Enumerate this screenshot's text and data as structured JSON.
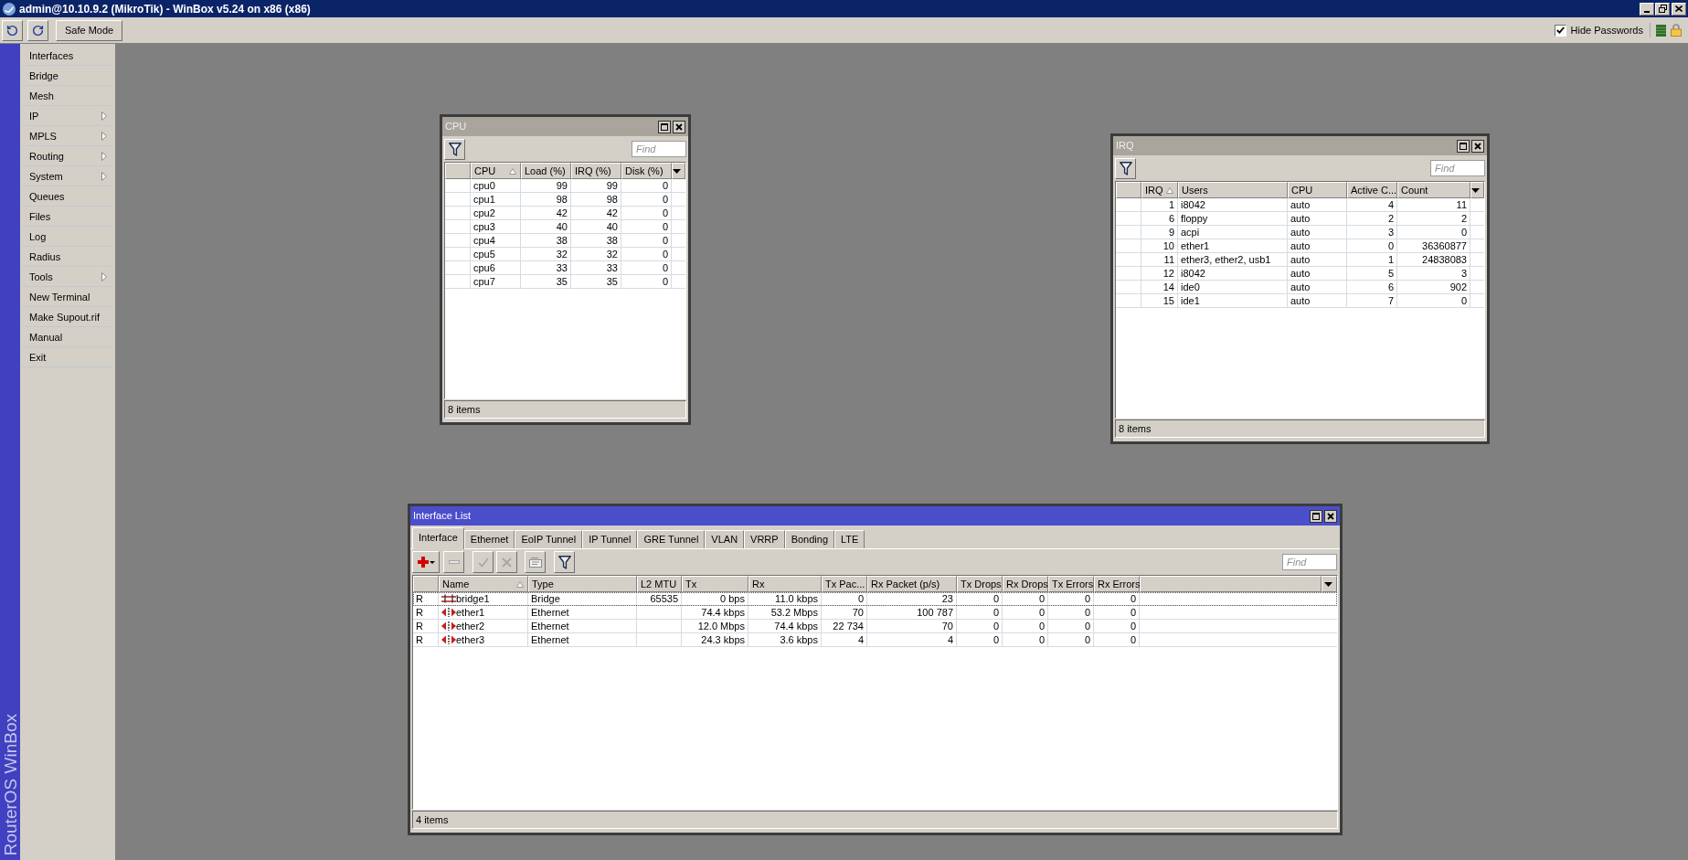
{
  "window": {
    "title": "admin@10.10.9.2 (MikroTik) - WinBox v5.24 on x86 (x86)"
  },
  "toolbar": {
    "safe_mode": {
      "label": "Safe Mode",
      "pressed": false
    },
    "hide_passwords": {
      "label": "Hide Passwords",
      "checked": true
    }
  },
  "sidebar": {
    "brand": "RouterOS WinBox",
    "items": [
      {
        "label": "Interfaces",
        "submenu": false
      },
      {
        "label": "Bridge",
        "submenu": false
      },
      {
        "label": "Mesh",
        "submenu": false
      },
      {
        "label": "IP",
        "submenu": true
      },
      {
        "label": "MPLS",
        "submenu": true
      },
      {
        "label": "Routing",
        "submenu": true
      },
      {
        "label": "System",
        "submenu": true
      },
      {
        "label": "Queues",
        "submenu": false
      },
      {
        "label": "Files",
        "submenu": false
      },
      {
        "label": "Log",
        "submenu": false
      },
      {
        "label": "Radius",
        "submenu": false
      },
      {
        "label": "Tools",
        "submenu": true
      },
      {
        "label": "New Terminal",
        "submenu": false
      },
      {
        "label": "Make Supout.rif",
        "submenu": false
      },
      {
        "label": "Manual",
        "submenu": false
      },
      {
        "label": "Exit",
        "submenu": false
      }
    ]
  },
  "cpu_window": {
    "title": "CPU",
    "active": false,
    "find": {
      "placeholder": "Find"
    },
    "columns": [
      {
        "label": "CPU",
        "sorted": true
      },
      {
        "label": "Load (%)",
        "sorted": false
      },
      {
        "label": "IRQ (%)",
        "sorted": false
      },
      {
        "label": "Disk (%)",
        "sorted": false
      }
    ],
    "rows": [
      [
        "cpu0",
        "99",
        "99",
        "0"
      ],
      [
        "cpu1",
        "98",
        "98",
        "0"
      ],
      [
        "cpu2",
        "42",
        "42",
        "0"
      ],
      [
        "cpu3",
        "40",
        "40",
        "0"
      ],
      [
        "cpu4",
        "38",
        "38",
        "0"
      ],
      [
        "cpu5",
        "32",
        "32",
        "0"
      ],
      [
        "cpu6",
        "33",
        "33",
        "0"
      ],
      [
        "cpu7",
        "35",
        "35",
        "0"
      ]
    ],
    "status": "8 items"
  },
  "irq_window": {
    "title": "IRQ",
    "active": false,
    "find": {
      "placeholder": "Find"
    },
    "columns": [
      {
        "label": "IRQ",
        "sorted": true
      },
      {
        "label": "Users",
        "sorted": false
      },
      {
        "label": "CPU",
        "sorted": false
      },
      {
        "label": "Active C...",
        "sorted": false
      },
      {
        "label": "Count",
        "sorted": false
      }
    ],
    "rows": [
      [
        "1",
        "i8042",
        "auto",
        "4",
        "11"
      ],
      [
        "6",
        "floppy",
        "auto",
        "2",
        "2"
      ],
      [
        "9",
        "acpi",
        "auto",
        "3",
        "0"
      ],
      [
        "10",
        "ether1",
        "auto",
        "0",
        "36360877"
      ],
      [
        "11",
        "ether3, ether2, usb1",
        "auto",
        "1",
        "24838083"
      ],
      [
        "12",
        "i8042",
        "auto",
        "5",
        "3"
      ],
      [
        "14",
        "ide0",
        "auto",
        "6",
        "902"
      ],
      [
        "15",
        "ide1",
        "auto",
        "7",
        "0"
      ]
    ],
    "status": "8 items"
  },
  "interface_window": {
    "title": "Interface List",
    "active": true,
    "tabs": [
      {
        "label": "Interface",
        "selected": true
      },
      {
        "label": "Ethernet",
        "selected": false
      },
      {
        "label": "EoIP Tunnel",
        "selected": false
      },
      {
        "label": "IP Tunnel",
        "selected": false
      },
      {
        "label": "GRE Tunnel",
        "selected": false
      },
      {
        "label": "VLAN",
        "selected": false
      },
      {
        "label": "VRRP",
        "selected": false
      },
      {
        "label": "Bonding",
        "selected": false
      },
      {
        "label": "LTE",
        "selected": false
      }
    ],
    "toolbar": [
      {
        "kind": "add",
        "disabled": false
      },
      {
        "kind": "remove",
        "disabled": true
      },
      {
        "kind": "enable",
        "disabled": true
      },
      {
        "kind": "disable",
        "disabled": true
      },
      {
        "kind": "comment",
        "disabled": true
      },
      {
        "kind": "filter",
        "disabled": false
      }
    ],
    "find": {
      "placeholder": "Find"
    },
    "columns": [
      {
        "label": "Name",
        "sorted": true
      },
      {
        "label": "Type",
        "sorted": false
      },
      {
        "label": "L2 MTU",
        "sorted": false
      },
      {
        "label": "Tx",
        "sorted": false
      },
      {
        "label": "Rx",
        "sorted": false
      },
      {
        "label": "Tx Pac...",
        "sorted": false
      },
      {
        "label": "Rx Packet (p/s)",
        "sorted": false
      },
      {
        "label": "Tx Drops",
        "sorted": false
      },
      {
        "label": "Rx Drops",
        "sorted": false
      },
      {
        "label": "Tx Errors",
        "sorted": false
      },
      {
        "label": "Rx Errors",
        "sorted": false
      }
    ],
    "rows": [
      {
        "flag": "R",
        "kind": "bridge",
        "focused": true,
        "name": "bridge1",
        "type": "Bridge",
        "l2_mtu": "65535",
        "tx": "0 bps",
        "rx": "11.0 kbps",
        "tx_packet": "0",
        "rx_packet": "23",
        "tx_drops": "0",
        "rx_drops": "0",
        "tx_errors": "0",
        "rx_errors": "0"
      },
      {
        "flag": "R",
        "kind": "ethernet",
        "focused": false,
        "name": "ether1",
        "type": "Ethernet",
        "tx": "74.4 kbps",
        "rx": "53.2 Mbps",
        "tx_packet": "70",
        "rx_packet": "100 787",
        "tx_drops": "0",
        "rx_drops": "0",
        "tx_errors": "0",
        "rx_errors": "0"
      },
      {
        "flag": "R",
        "kind": "ethernet",
        "focused": false,
        "name": "ether2",
        "type": "Ethernet",
        "tx": "12.0 Mbps",
        "rx": "74.4 kbps",
        "tx_packet": "22 734",
        "rx_packet": "70",
        "tx_drops": "0",
        "rx_drops": "0",
        "tx_errors": "0",
        "rx_errors": "0"
      },
      {
        "flag": "R",
        "kind": "ethernet",
        "focused": false,
        "name": "ether3",
        "type": "Ethernet",
        "tx": "24.3 kbps",
        "rx": "3.6 kbps",
        "tx_packet": "4",
        "rx_packet": "4",
        "tx_drops": "0",
        "rx_drops": "0",
        "tx_errors": "0",
        "rx_errors": "0"
      }
    ],
    "status": "4 items"
  }
}
